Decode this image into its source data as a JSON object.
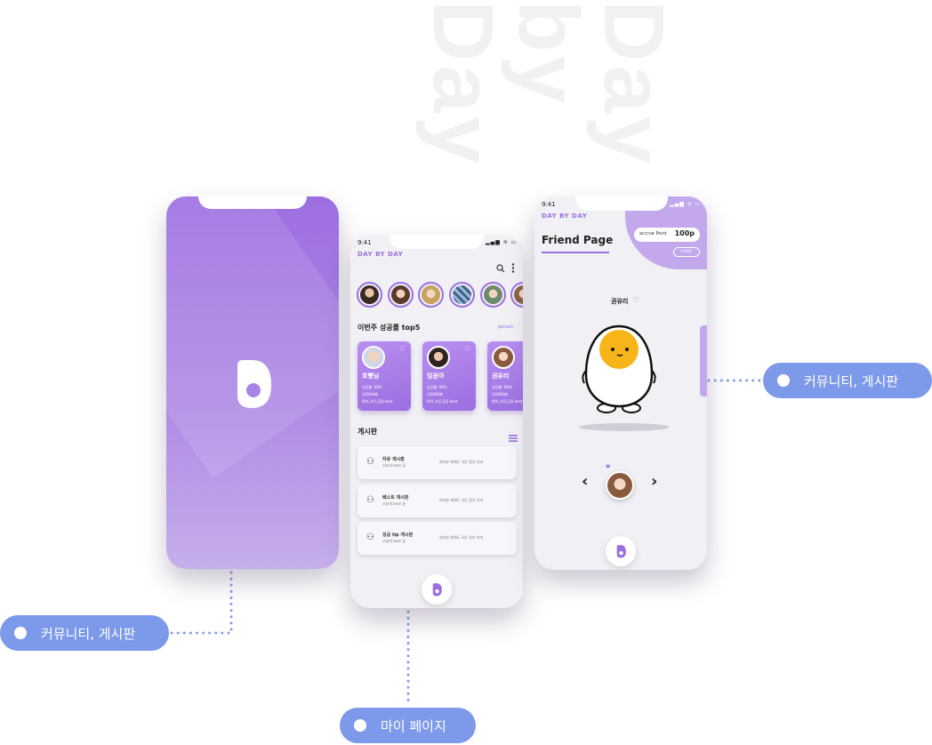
{
  "background_title": "Day by Day",
  "colors": {
    "accent": "#9a70df",
    "tag": "#7d9aea",
    "card": "#a77fe6"
  },
  "splash": {
    "logo": "D"
  },
  "home": {
    "status_time": "9:41",
    "status_icons": "signal-wifi-battery-icons",
    "brand": "DAY BY DAY",
    "icons": [
      "search-icon",
      "more-vertical-icon"
    ],
    "story_count": 6,
    "top5": {
      "title": "이번주 성공률 top5",
      "link": "person",
      "cards": [
        {
          "name": "호빵님",
          "rate": "성공률: 98%",
          "line2": "1200회째",
          "line3": "뛰어,고민,공동 best"
        },
        {
          "name": "임윤아",
          "rate": "성공률: 98%",
          "line2": "1200회째",
          "line3": "뛰어,고민,공동 best"
        },
        {
          "name": "권유리",
          "rate": "성공률: 98%",
          "line2": "1200회째",
          "line3": "뛰어,고민,공동 best"
        }
      ]
    },
    "board": {
      "title": "게시판",
      "rows": [
        {
          "title": "자유 게시판",
          "sub": "오늘의 best 글",
          "desc": "여러분 재해도 사은 잡다 하지"
        },
        {
          "title": "베스트 게시판",
          "sub": "오늘의 best 글",
          "desc": "여러분 재해도 사은 잡다 하지"
        },
        {
          "title": "성공 tip 게시판",
          "sub": "오늘의 best 글",
          "desc": "여러분 재해도 사은 잡다 하지"
        }
      ]
    },
    "fab_logo": "D"
  },
  "friend": {
    "status_time": "9:41",
    "brand": "DAY BY DAY",
    "title": "Friend Page",
    "points_label": "accrue Point",
    "points_value": "100p",
    "mart_label": "mart",
    "friend_name": "권유리",
    "heart": "♡",
    "prev": "‹",
    "next": "›",
    "fab_logo": "D"
  },
  "tags": {
    "left": "커뮤니티, 게시판",
    "bottom": "마이 페이지",
    "right": "커뮤니티, 게시판"
  }
}
